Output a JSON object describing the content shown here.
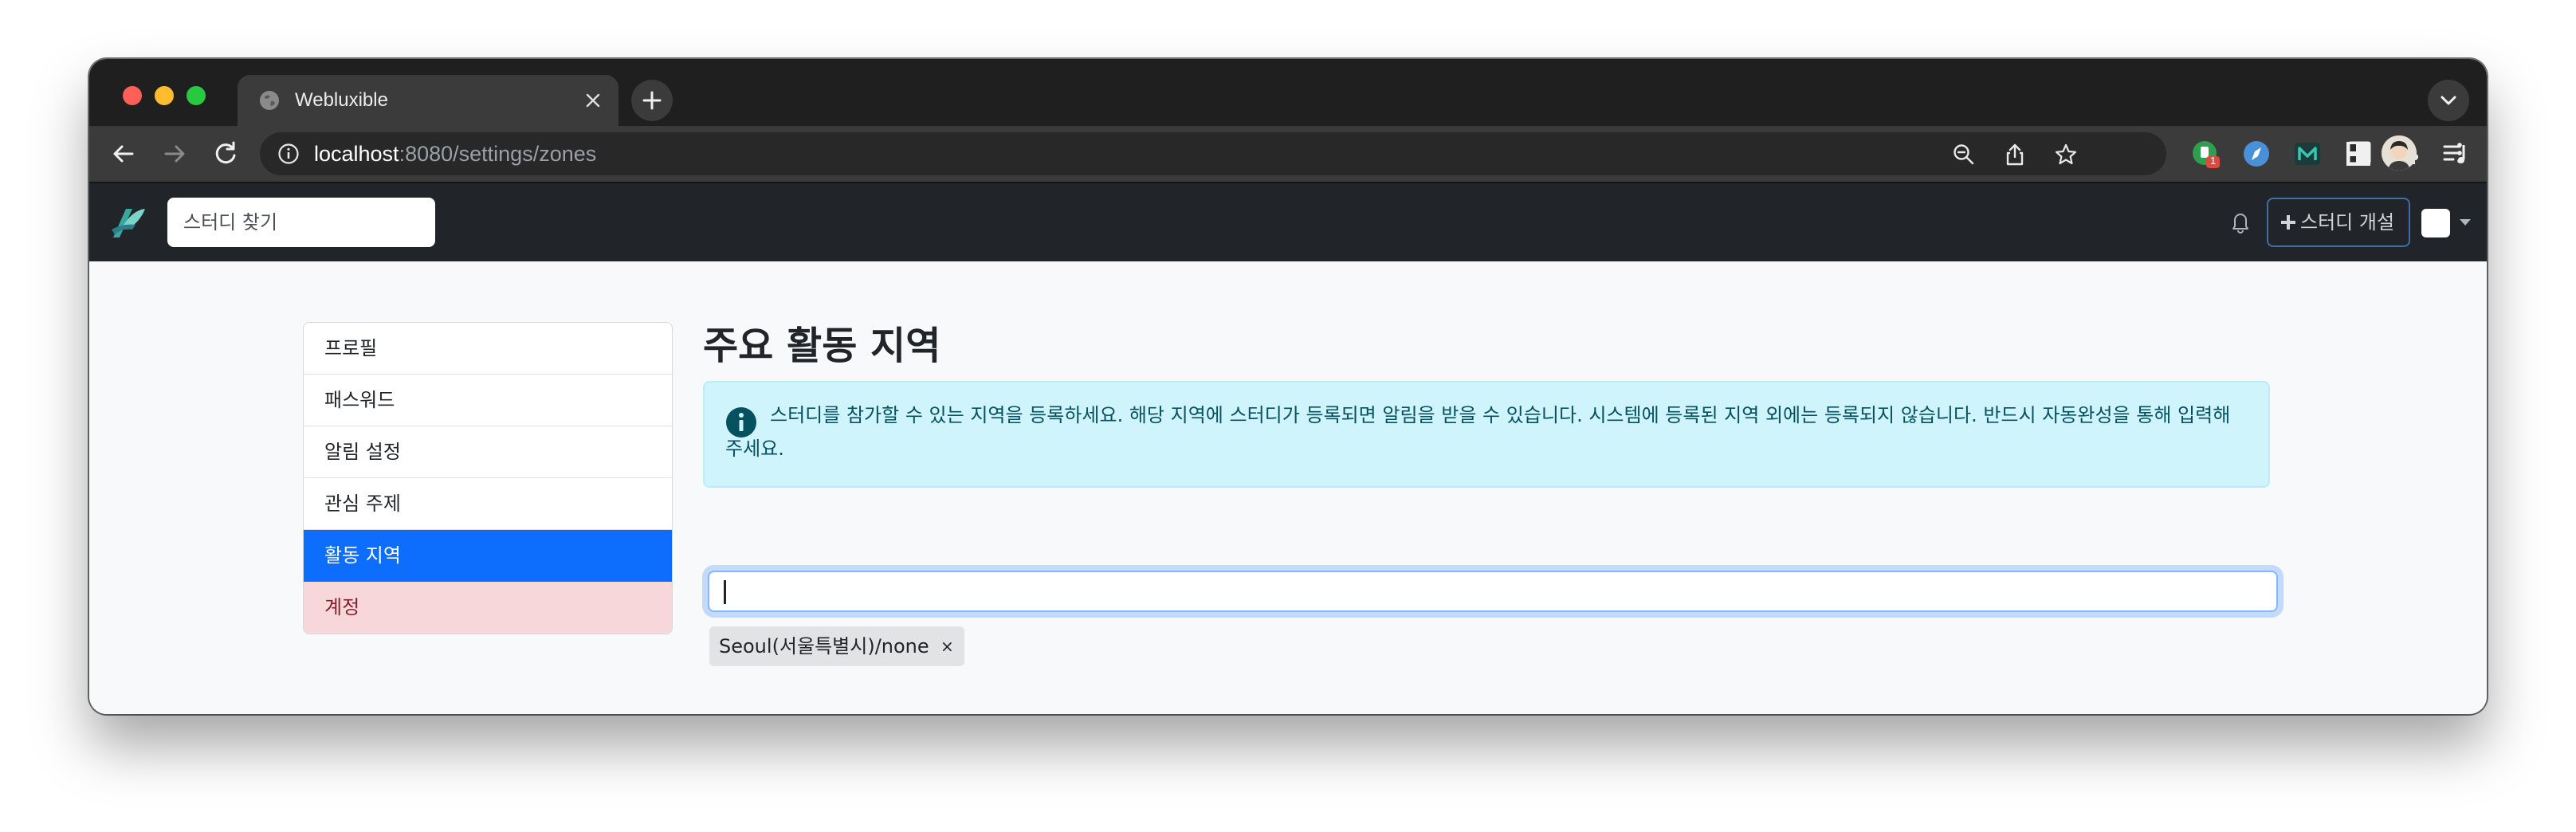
{
  "browser": {
    "tab_title": "Webluxible",
    "url_host": "localhost",
    "url_rest": ":8080/settings/zones",
    "extension_badge": "1"
  },
  "navbar": {
    "search_placeholder": "스터디 찾기",
    "open_study_label": "스터디 개설"
  },
  "sidebar": {
    "items": [
      {
        "label": "프로필",
        "state": "default"
      },
      {
        "label": "패스워드",
        "state": "default"
      },
      {
        "label": "알림 설정",
        "state": "default"
      },
      {
        "label": "관심 주제",
        "state": "default"
      },
      {
        "label": "활동 지역",
        "state": "active"
      },
      {
        "label": "계정",
        "state": "danger"
      }
    ]
  },
  "main": {
    "title": "주요 활동 지역",
    "alert_text": "스터디를 참가할 수 있는 지역을 등록하세요. 해당 지역에 스터디가 등록되면 알림을 받을 수 있습니다. 시스템에 등록된 지역 외에는 등록되지 않습니다. 반드시 자동완성을 통해 입력해주세요.",
    "input_value": "",
    "tags": [
      {
        "label": "Seoul(서울특별시)/none",
        "remove": "×"
      }
    ]
  },
  "colors": {
    "accent": "#0d6efd",
    "navbar_bg": "#212529",
    "alert_bg": "#cff4fc",
    "danger_bg": "#f8d7da"
  }
}
